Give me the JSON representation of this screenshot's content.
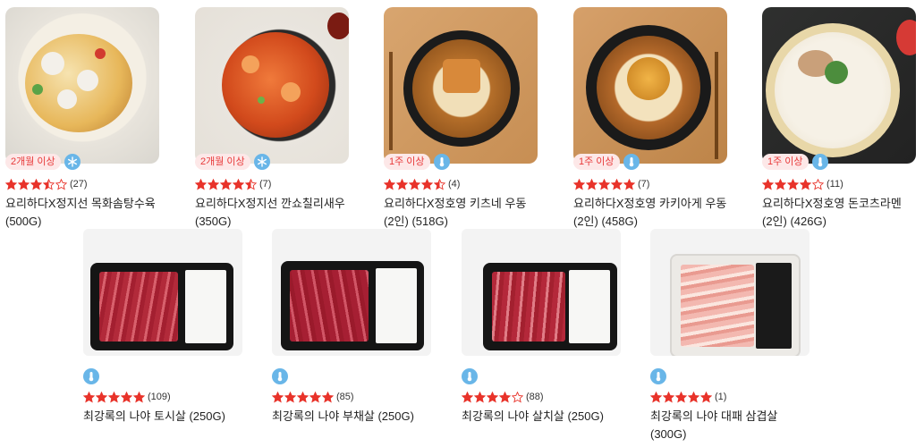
{
  "products": [
    {
      "badge": "2개월 이상",
      "storage": "frozen",
      "rating": 3.5,
      "count": "(27)",
      "name": "요리하다X정지선 목화솜탕수육 (500G)"
    },
    {
      "badge": "2개월 이상",
      "storage": "frozen",
      "rating": 4.5,
      "count": "(7)",
      "name": "요리하다X정지선 깐쇼칠리새우 (350G)"
    },
    {
      "badge": "1주 이상",
      "storage": "refrigerated",
      "rating": 4.5,
      "count": "(4)",
      "name": "요리하다X정호영 키츠네 우동 (2인) (518G)"
    },
    {
      "badge": "1주 이상",
      "storage": "refrigerated",
      "rating": 5,
      "count": "(7)",
      "name": "요리하다X정호영 카키아게 우동 (2인) (458G)"
    },
    {
      "badge": "1주 이상",
      "storage": "refrigerated",
      "rating": 4,
      "count": "(11)",
      "name": "요리하다X정호영 돈코츠라멘 (2인) (426G)"
    },
    {
      "badge": "",
      "storage": "refrigerated",
      "rating": 5,
      "count": "(109)",
      "name": "최강록의 나야 토시살 (250G)"
    },
    {
      "badge": "",
      "storage": "refrigerated",
      "rating": 5,
      "count": "(85)",
      "name": "최강록의 나야 부채살 (250G)"
    },
    {
      "badge": "",
      "storage": "refrigerated",
      "rating": 4,
      "count": "(88)",
      "name": "최강록의 나야 살치살 (250G)"
    },
    {
      "badge": "",
      "storage": "refrigerated",
      "rating": 5,
      "count": "(1)",
      "name": "최강록의 나야 대패 삼겹살 (300G)"
    }
  ],
  "colors": {
    "star": "#e8332a",
    "badge_text": "#e83a3a",
    "badge_bg": "#fde8e8",
    "cool_icon": "#69b6e8"
  }
}
